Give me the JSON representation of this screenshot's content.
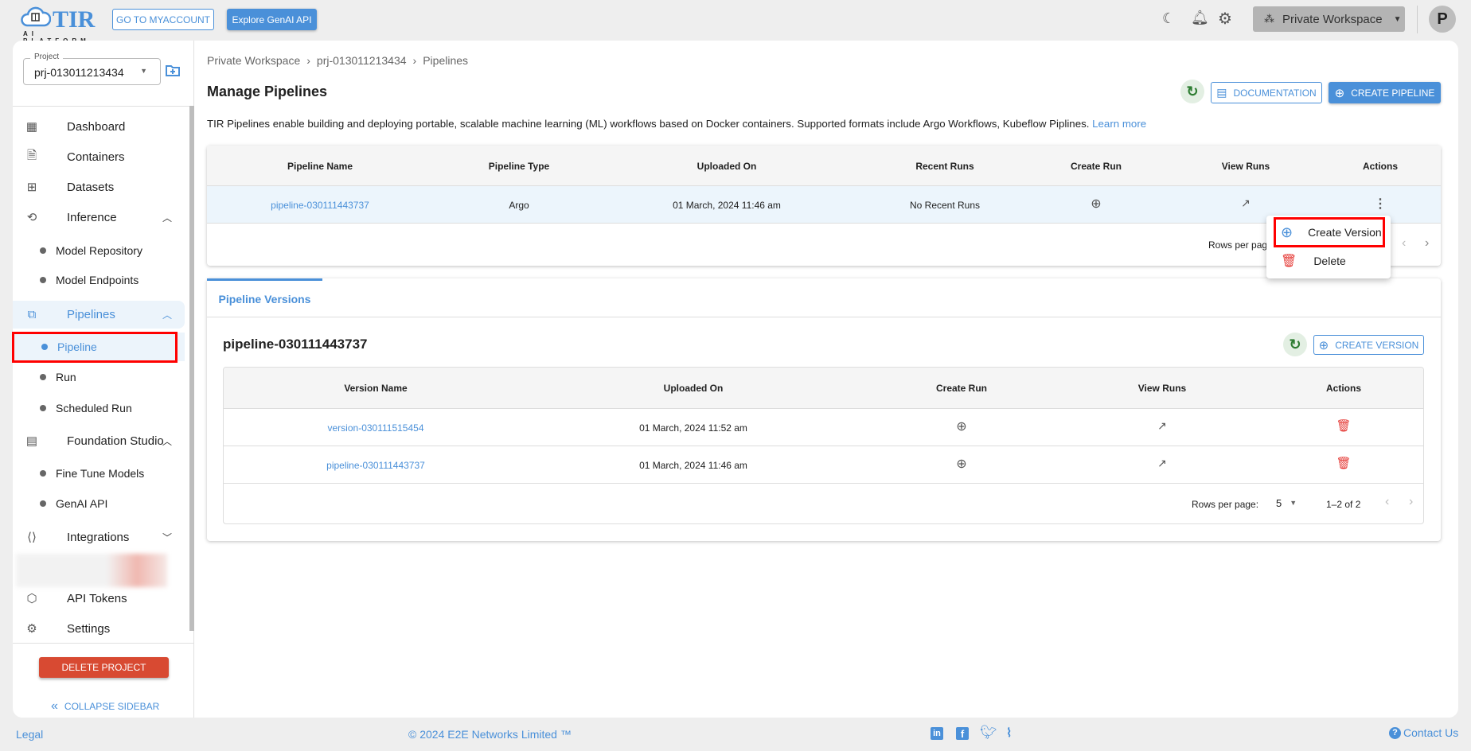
{
  "header": {
    "logo_text": "TIR",
    "logo_sub": "AI PLATFORM",
    "myaccount_label": "GO TO MYACCOUNT",
    "genai_label": "Explore GenAI API",
    "workspace_label": "Private Workspace",
    "avatar_letter": "P"
  },
  "sidebar": {
    "project_label": "Project",
    "project_value": "prj-013011213434",
    "items": {
      "dashboard": "Dashboard",
      "containers": "Containers",
      "datasets": "Datasets",
      "inference": "Inference",
      "model_repository": "Model Repository",
      "model_endpoints": "Model Endpoints",
      "pipelines": "Pipelines",
      "pipeline": "Pipeline",
      "run": "Run",
      "scheduled_run": "Scheduled Run",
      "foundation_studio": "Foundation Studio",
      "fine_tune": "Fine Tune Models",
      "genai_api": "GenAI API",
      "integrations": "Integrations",
      "api_tokens": "API Tokens",
      "settings": "Settings"
    },
    "delete_project": "DELETE PROJECT",
    "collapse": "COLLAPSE SIDEBAR"
  },
  "main": {
    "breadcrumb": [
      "Private Workspace",
      "prj-013011213434",
      "Pipelines"
    ],
    "title": "Manage Pipelines",
    "documentation_label": "DOCUMENTATION",
    "create_pipeline_label": "CREATE PIPELINE",
    "description": "TIR Pipelines enable building and deploying portable, scalable machine learning (ML) workflows based on Docker containers. Supported formats include Argo Workflows, Kubeflow Piplines.",
    "learn_more": "Learn more",
    "pipelines_table": {
      "columns": [
        "Pipeline Name",
        "Pipeline Type",
        "Uploaded On",
        "Recent Runs",
        "Create Run",
        "View Runs",
        "Actions"
      ],
      "rows": [
        {
          "name": "pipeline-030111443737",
          "type": "Argo",
          "uploaded": "01 March, 2024 11:46 am",
          "recent": "No Recent Runs"
        }
      ],
      "rows_per_page": "Rows per page"
    },
    "menu": {
      "create_version": "Create Version",
      "delete": "Delete"
    },
    "versions": {
      "tab": "Pipeline Versions",
      "title": "pipeline-030111443737",
      "create_version_label": "CREATE VERSION",
      "columns": [
        "Version Name",
        "Uploaded On",
        "Create Run",
        "View Runs",
        "Actions"
      ],
      "rows": [
        {
          "name": "version-030111515454",
          "uploaded": "01 March, 2024 11:52 am"
        },
        {
          "name": "pipeline-030111443737",
          "uploaded": "01 March, 2024 11:46 am"
        }
      ],
      "rows_per_page": "Rows per page:",
      "per_page_value": "5",
      "range": "1–2 of 2"
    }
  },
  "footer": {
    "legal": "Legal",
    "copyright": "© 2024 E2E Networks Limited ™",
    "contact": "Contact Us"
  },
  "colors": {
    "accent": "#4a90d9",
    "danger": "#d84a32",
    "highlight": "#ff0000"
  }
}
